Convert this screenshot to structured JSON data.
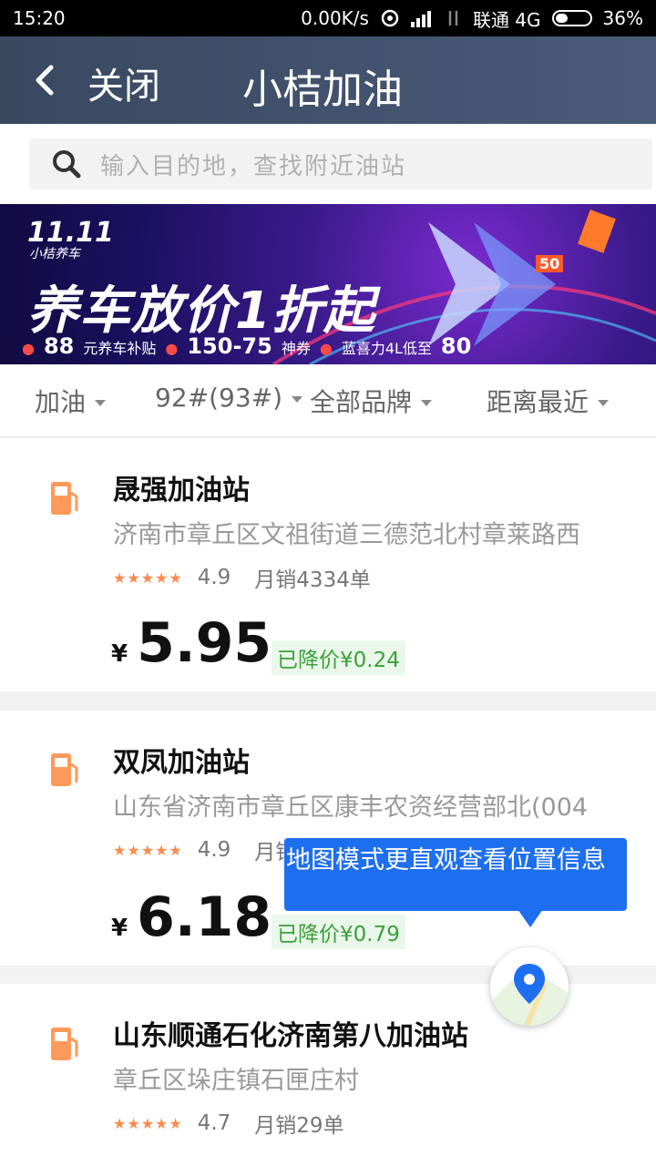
{
  "status_bar": {
    "time": "15:20",
    "network_speed": "0.00K/s",
    "carrier": "联通 4G",
    "battery": "36%",
    "battery_level": 0.36
  },
  "navbar": {
    "close_label": "关闭",
    "title": "小桔加油"
  },
  "search": {
    "placeholder": "输入目的地，查找附近油站"
  },
  "banner": {
    "tag": "11.11",
    "tag_sub": "小桔养车",
    "headline": "养车放价1折起",
    "perks": [
      {
        "big": "88",
        "text": "元养车补贴"
      },
      {
        "big": "150-75",
        "text": "神券"
      },
      {
        "big": "80",
        "text": "蓝喜力4L低至"
      }
    ],
    "badge": "50"
  },
  "filters": [
    {
      "label": "加油"
    },
    {
      "label": "92#(93#)"
    },
    {
      "label": "全部品牌"
    },
    {
      "label": "距离最近"
    }
  ],
  "stations": [
    {
      "name": "晟强加油站",
      "address": "济南市章丘区文祖街道三德范北村章莱路西",
      "stars": "★★★★★",
      "score": "4.9",
      "sales": "月销4334单",
      "currency": "¥",
      "price": "5.95",
      "discount": "已降价¥0.24"
    },
    {
      "name": "双凤加油站",
      "address": "山东省济南市章丘区康丰农资经营部北(004",
      "stars": "★★★★★",
      "score": "4.9",
      "sales": "月销",
      "currency": "¥",
      "price": "6.18",
      "discount": "已降价¥0.79"
    },
    {
      "name": "山东顺通石化济南第八加油站",
      "address": "章丘区垛庄镇石匣庄村",
      "stars": "★★★★★",
      "score": "4.7",
      "sales": "月销29单"
    }
  ],
  "tooltip": {
    "text": "地图模式更直观查看位置信息"
  },
  "colors": {
    "navbar": "#3a4860",
    "accent_orange": "#ff8a4c",
    "discount_green": "#3ca03c",
    "tooltip_blue": "#1e6ff0"
  }
}
